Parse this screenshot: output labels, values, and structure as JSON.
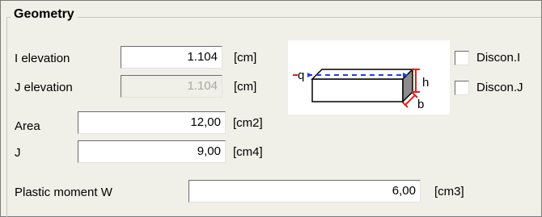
{
  "group": {
    "title": "Geometry"
  },
  "fields": {
    "i_elevation": {
      "label": "I elevation",
      "value": "1.104",
      "unit": "[cm]"
    },
    "j_elevation": {
      "label": "J elevation",
      "value": "1.104",
      "unit": "[cm]"
    },
    "area": {
      "label": "Area",
      "value": "12,00",
      "unit": "[cm2]"
    },
    "j": {
      "label": "J",
      "value": "9,00",
      "unit": "[cm4]"
    },
    "plastic_moment": {
      "label": "Plastic moment W",
      "value": "6,00",
      "unit": "[cm3]"
    }
  },
  "diagram": {
    "q_label": "q",
    "h_label": "h",
    "b_label": "b"
  },
  "checkboxes": {
    "discon_i": {
      "label": "Discon.I",
      "checked": false
    },
    "discon_j": {
      "label": "Discon.J",
      "checked": false
    }
  }
}
